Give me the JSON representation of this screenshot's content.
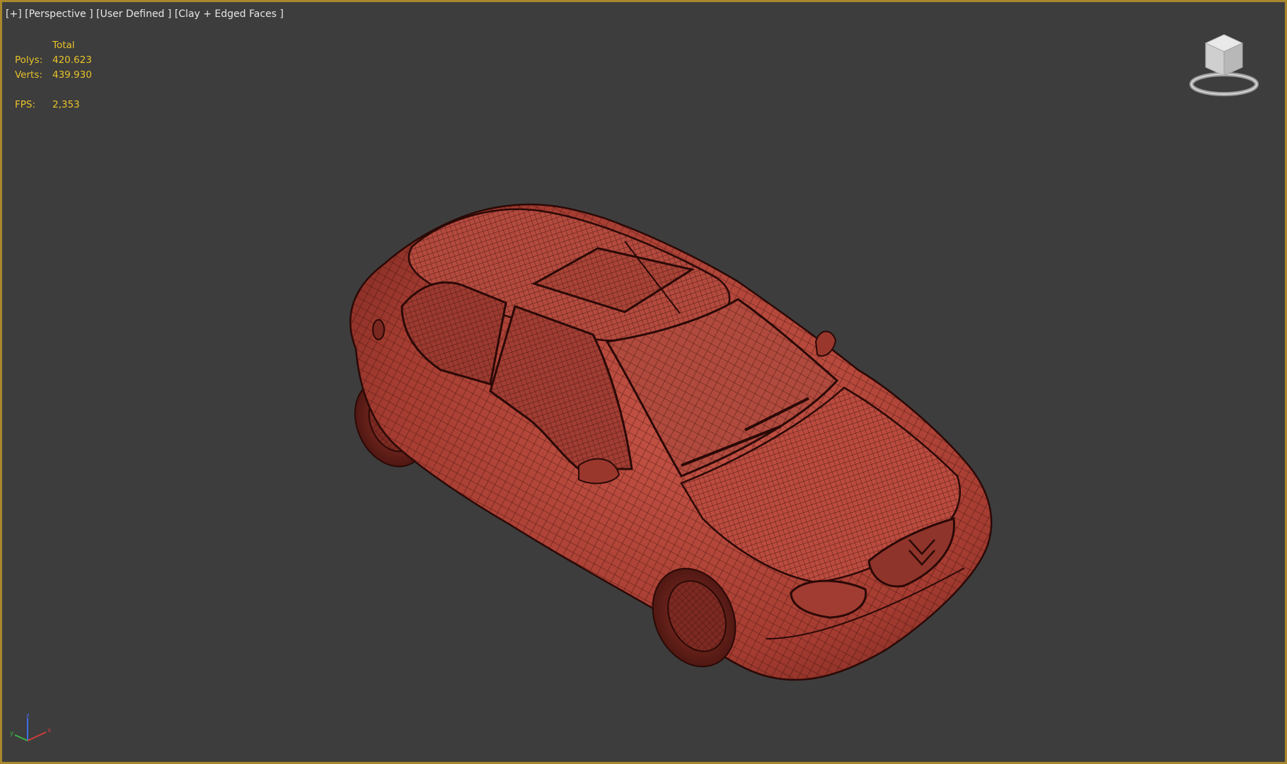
{
  "viewport": {
    "label": {
      "plus": "[+]",
      "view": "[Perspective ]",
      "mode": "[User Defined ]",
      "shading": "[Clay + Edged Faces ]"
    },
    "border_color": "#a8882c",
    "background_color": "#3d3d3d"
  },
  "stats": {
    "header": "Total",
    "polys_label": "Polys:",
    "polys_value": "420.623",
    "verts_label": "Verts:",
    "verts_value": "439.930",
    "fps_label": "FPS:",
    "fps_value": "2,353",
    "color": "#e8c22a"
  },
  "scene": {
    "model": "hatchback-car-wireframe",
    "clay_color": "#b8463a",
    "edge_color": "#3a0f0a"
  },
  "icons": {
    "viewcube": "viewcube-icon",
    "axis": "axis-tripod-icon"
  },
  "axis_labels": {
    "x": "x",
    "y": "y",
    "z": "z"
  }
}
